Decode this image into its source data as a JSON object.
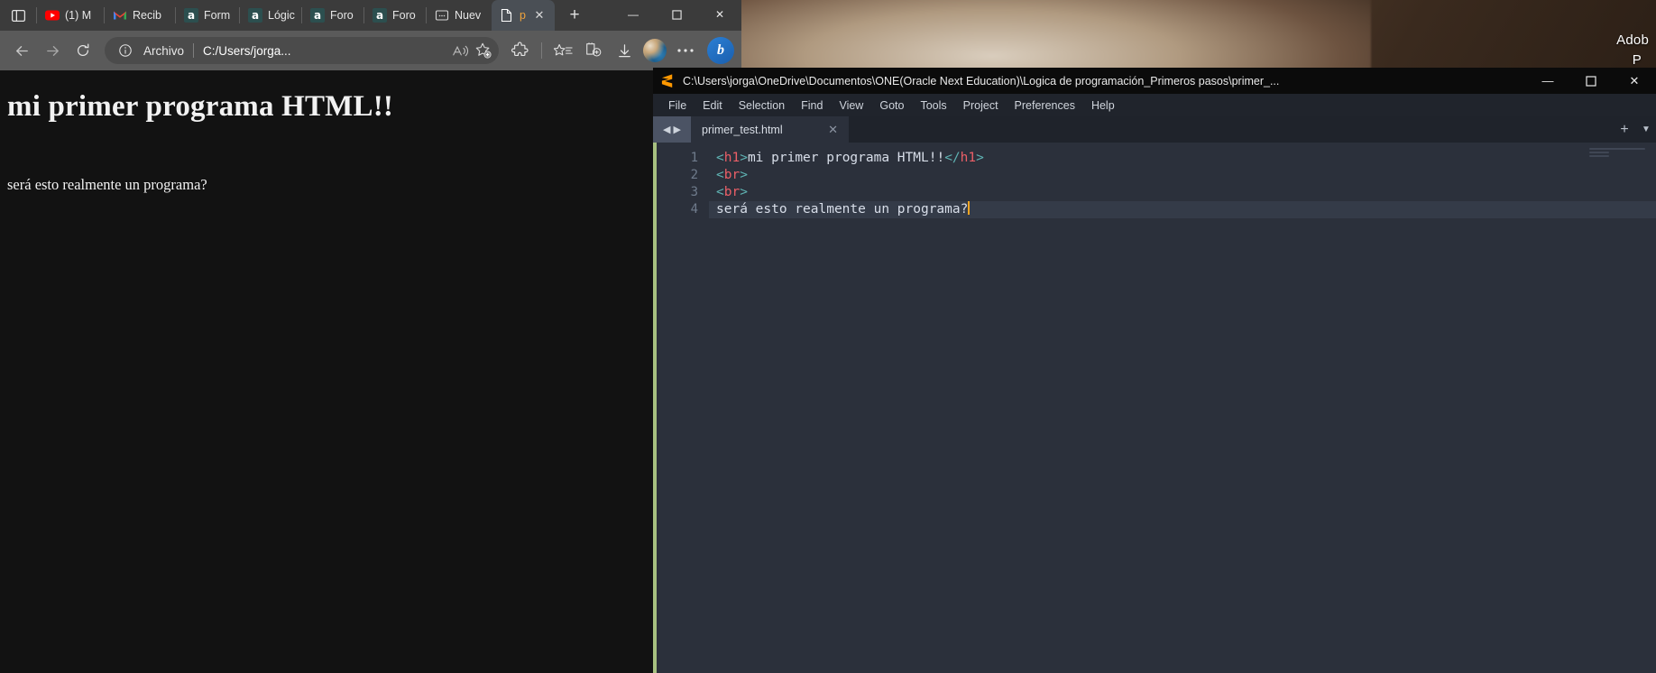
{
  "desktop": {
    "right_text_1": "Adob",
    "right_text_2": "P"
  },
  "browser": {
    "tabs": [
      {
        "label": "(1) M",
        "icon": "youtube-icon"
      },
      {
        "label": "Recib",
        "icon": "gmail-icon"
      },
      {
        "label": "Form",
        "icon": "alura-icon"
      },
      {
        "label": "Lógic",
        "icon": "alura-icon"
      },
      {
        "label": "Foro",
        "icon": "alura-icon"
      },
      {
        "label": "Foro",
        "icon": "alura-icon"
      },
      {
        "label": "Nuev",
        "icon": "generic-page-icon"
      }
    ],
    "active_tab": {
      "label": "p",
      "icon": "file-icon"
    },
    "new_tab_label": "+",
    "window_controls": {
      "minimize": "—",
      "maximize": "☐",
      "close": "✕"
    },
    "toolbar": {
      "back_icon": "back-arrow-icon",
      "forward_icon": "forward-arrow-icon",
      "reload_icon": "reload-icon",
      "info_icon": "info-icon",
      "scheme_label": "Archivo",
      "url": "C:/Users/jorga...",
      "read_aloud_icon": "read-aloud-icon",
      "add_favorite_icon": "add-favorite-star-icon",
      "extensions_icon": "extensions-puzzle-icon",
      "favorites_icon": "favorites-list-icon",
      "collections_icon": "collections-icon",
      "downloads_icon": "downloads-icon",
      "avatar_icon": "profile-avatar",
      "copilot_label": "b"
    },
    "page": {
      "heading": "mi primer programa HTML!!",
      "paragraph": "será esto realmente un programa?"
    }
  },
  "sublime": {
    "title": "C:\\Users\\jorga\\OneDrive\\Documentos\\ONE(Oracle Next Education)\\Logica de programación_Primeros pasos\\primer_...",
    "logo_icon": "sublime-text-icon",
    "window_controls": {
      "minimize": "—",
      "maximize": "☐",
      "close": "✕"
    },
    "menu": [
      "File",
      "Edit",
      "Selection",
      "Find",
      "View",
      "Goto",
      "Tools",
      "Project",
      "Preferences",
      "Help"
    ],
    "nav_back_icon": "nav-back-arrow-icon",
    "nav_forward_icon": "nav-forward-arrow-icon",
    "tab": {
      "name": "primer_test.html",
      "close_icon": "close-icon"
    },
    "tab_plus": "+",
    "tab_chevron": "▼",
    "gutter": [
      "1",
      "2",
      "3",
      "4"
    ],
    "code": [
      {
        "segments": [
          {
            "t": "<",
            "c": "c-punct"
          },
          {
            "t": "h1",
            "c": "c-tag"
          },
          {
            "t": ">",
            "c": "c-punct"
          },
          {
            "t": "mi primer programa HTML!!",
            "c": "c-text"
          },
          {
            "t": "</",
            "c": "c-punct"
          },
          {
            "t": "h1",
            "c": "c-tag"
          },
          {
            "t": ">",
            "c": "c-punct"
          }
        ],
        "active": false
      },
      {
        "segments": [
          {
            "t": "<",
            "c": "c-punct"
          },
          {
            "t": "br",
            "c": "c-tag"
          },
          {
            "t": ">",
            "c": "c-punct"
          }
        ],
        "active": false
      },
      {
        "segments": [
          {
            "t": "<",
            "c": "c-punct"
          },
          {
            "t": "br",
            "c": "c-tag"
          },
          {
            "t": ">",
            "c": "c-punct"
          }
        ],
        "active": false
      },
      {
        "segments": [
          {
            "t": "será esto realmente un programa?",
            "c": "c-text"
          }
        ],
        "active": true,
        "caret": true
      }
    ]
  }
}
